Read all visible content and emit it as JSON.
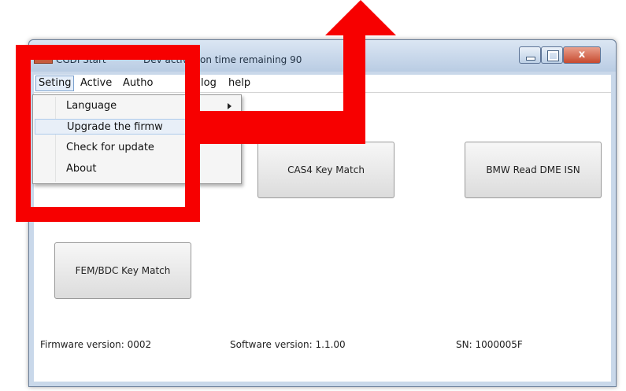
{
  "window": {
    "title": "CGDI Start",
    "status": "Dev    activation time remaining 90",
    "close_glyph": "x"
  },
  "menubar": {
    "items": [
      "Seting",
      "Active",
      "Autho",
      "log",
      "help"
    ]
  },
  "dropdown": {
    "items": [
      "Language",
      "Upgrade the firmw",
      "Check for update",
      "About"
    ]
  },
  "buttons": {
    "cas4": "CAS4 Key Match",
    "bmw_dme": "BMW Read DME ISN",
    "fem_bdc": "FEM/BDC Key Match"
  },
  "info": {
    "firmware": "Firmware version: 0002",
    "software": "Software version:  1.1.00",
    "sn": "SN:   1000005F"
  },
  "colors": {
    "annotation_red": "#f70000",
    "titlebar": "#c9d8ea",
    "close_button": "#c74a2f"
  }
}
